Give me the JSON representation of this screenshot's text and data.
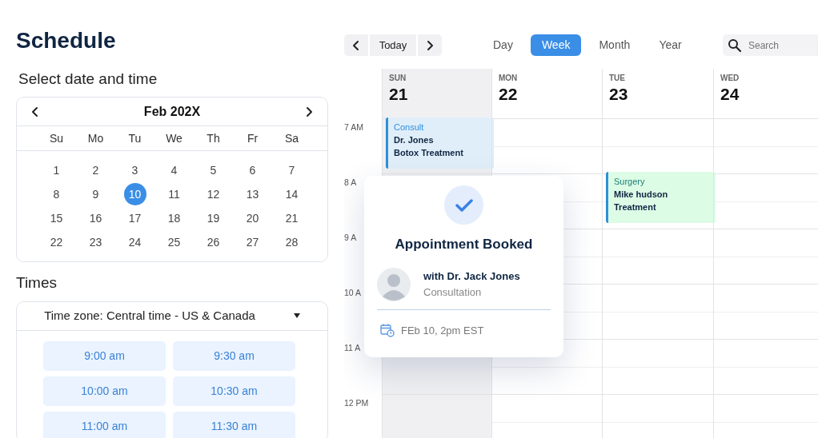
{
  "title": "Schedule",
  "date_picker": {
    "label": "Select date and time",
    "month": "Feb 202X",
    "weekdays": [
      "Su",
      "Mo",
      "Tu",
      "We",
      "Th",
      "Fr",
      "Sa"
    ],
    "weeks": [
      [
        {
          "day": "1",
          "selected": false
        },
        {
          "day": "2",
          "selected": false
        },
        {
          "day": "3",
          "selected": false
        },
        {
          "day": "4",
          "selected": false
        },
        {
          "day": "5",
          "selected": false
        },
        {
          "day": "6",
          "selected": false
        },
        {
          "day": "7",
          "selected": false
        }
      ],
      [
        {
          "day": "8",
          "selected": false
        },
        {
          "day": "9",
          "selected": false
        },
        {
          "day": "10",
          "selected": true
        },
        {
          "day": "11",
          "selected": false
        },
        {
          "day": "12",
          "selected": false
        },
        {
          "day": "13",
          "selected": false
        },
        {
          "day": "14",
          "selected": false
        }
      ],
      [
        {
          "day": "15",
          "selected": false
        },
        {
          "day": "16",
          "selected": false
        },
        {
          "day": "17",
          "selected": false
        },
        {
          "day": "18",
          "selected": false
        },
        {
          "day": "19",
          "selected": false
        },
        {
          "day": "20",
          "selected": false
        },
        {
          "day": "21",
          "selected": false
        }
      ],
      [
        {
          "day": "22",
          "selected": false
        },
        {
          "day": "23",
          "selected": false
        },
        {
          "day": "24",
          "selected": false
        },
        {
          "day": "25",
          "selected": false
        },
        {
          "day": "26",
          "selected": false
        },
        {
          "day": "27",
          "selected": false
        },
        {
          "day": "28",
          "selected": false
        }
      ]
    ]
  },
  "times": {
    "label": "Times",
    "timezone": "Time zone: Central time - US & Canada",
    "slots": [
      "9:00 am",
      "9:30 am",
      "10:00 am",
      "10:30 am",
      "11:00 am",
      "11:30 am"
    ]
  },
  "toolbar": {
    "today": "Today",
    "views": [
      {
        "label": "Day",
        "selected": false
      },
      {
        "label": "Week",
        "selected": true
      },
      {
        "label": "Month",
        "selected": false
      },
      {
        "label": "Year",
        "selected": false
      }
    ],
    "search": {
      "placeholder": "Search"
    }
  },
  "week": {
    "hours": [
      "7 AM",
      "8 A",
      "9 A",
      "10 A",
      "11 A",
      "12 PM"
    ],
    "days": [
      {
        "name": "SUN",
        "date": "21",
        "highlighted": true,
        "events": [
          {
            "kind": "consult",
            "title": "Consult",
            "lines": [
              "Dr. Jones",
              "Botox Treatment"
            ],
            "color": "#e0eef9"
          }
        ]
      },
      {
        "name": "MON",
        "date": "22",
        "highlighted": false
      },
      {
        "name": "TUE",
        "date": "23",
        "highlighted": false,
        "events": [
          {
            "kind": "surgery",
            "title": "Surgery",
            "lines": [
              "Mike hudson",
              "Treatment"
            ],
            "color": "#dcfce6"
          }
        ]
      },
      {
        "name": "WED",
        "date": "24",
        "highlighted": false
      }
    ]
  },
  "popup": {
    "title": "Appointment Booked",
    "doctor": "with Dr. Jack Jones",
    "type": "Consultation",
    "when": "FEb 10, 2pm EST"
  }
}
